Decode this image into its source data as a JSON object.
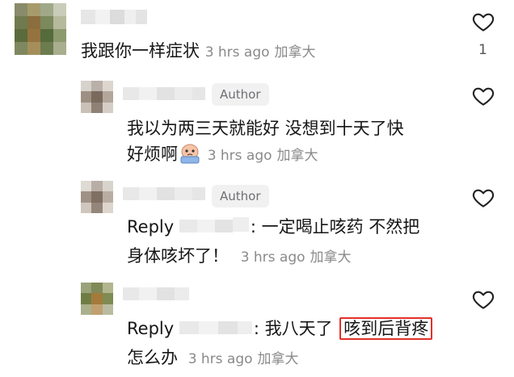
{
  "comments": [
    {
      "text": "我跟你一样症状",
      "time": "3 hrs ago",
      "location": "加拿大",
      "likes": "1"
    },
    {
      "badge": "Author",
      "line1": "我以为两三天就能好 没想到十天了快",
      "line2": "好烦啊",
      "emoji": "crying-face-emoji",
      "time": "3 hrs ago",
      "location": "加拿大"
    },
    {
      "badge": "Author",
      "reply_label": "Reply",
      "line1": ": 一定喝止咳药 不然把",
      "line2": "身体咳坏了！",
      "time": "3 hrs ago",
      "location": "加拿大"
    },
    {
      "reply_label": "Reply",
      "line1_pre": ": 我八天了 ",
      "highlighted": "咳到后背疼",
      "line2": "怎么办",
      "time": "3 hrs ago",
      "location": "加拿大"
    }
  ],
  "colors": {
    "highlight_border": "#e3302a",
    "meta_gray": "#8a8a8a",
    "badge_bg": "#f1f1f2"
  },
  "icons": [
    "heart-outline-icon"
  ]
}
